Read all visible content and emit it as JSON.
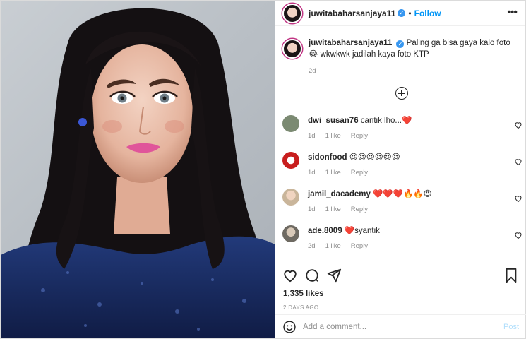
{
  "post": {
    "username": "juwitabaharsanjaya11",
    "verified_glyph": "✓",
    "separator": "•",
    "follow_label": "Follow",
    "more_glyph": "•••",
    "caption_text": "Paling ga bisa gaya kalo foto😂 wkwkwk jadilah kaya foto KTP",
    "caption_time": "2d"
  },
  "comments": [
    {
      "username": "dwi_susan76",
      "text": "cantik lho...❤️",
      "time": "1d",
      "likes": "1 like",
      "reply": "Reply",
      "avatar_color": "#7b8a72"
    },
    {
      "username": "sidonfood",
      "text": "😍😍😍😍😍😍",
      "time": "1d",
      "likes": "1 like",
      "reply": "Reply",
      "avatar_color": "#c81e1e"
    },
    {
      "username": "jamil_dacademy",
      "text": "❤️❤️❤️🔥🔥😍",
      "time": "1d",
      "likes": "1 like",
      "reply": "Reply",
      "avatar_color": "#c9b59a"
    },
    {
      "username": "ade.8009",
      "text": "❤️syantik",
      "time": "2d",
      "likes": "1 like",
      "reply": "Reply",
      "avatar_color": "#6e6a62"
    }
  ],
  "actions": {
    "likes": "1,335 likes",
    "posted_ago": "2 DAYS AGO"
  },
  "add_comment": {
    "placeholder": "Add a comment...",
    "post_label": "Post"
  },
  "icons": [
    "more-options-icon",
    "load-more-comments-icon",
    "heart-icon",
    "comment-icon",
    "share-icon",
    "bookmark-icon",
    "emoji-icon"
  ],
  "colors": {
    "accent": "#0095f6",
    "verified": "#3897f0",
    "muted": "#8e8e8e",
    "text": "#262626"
  }
}
